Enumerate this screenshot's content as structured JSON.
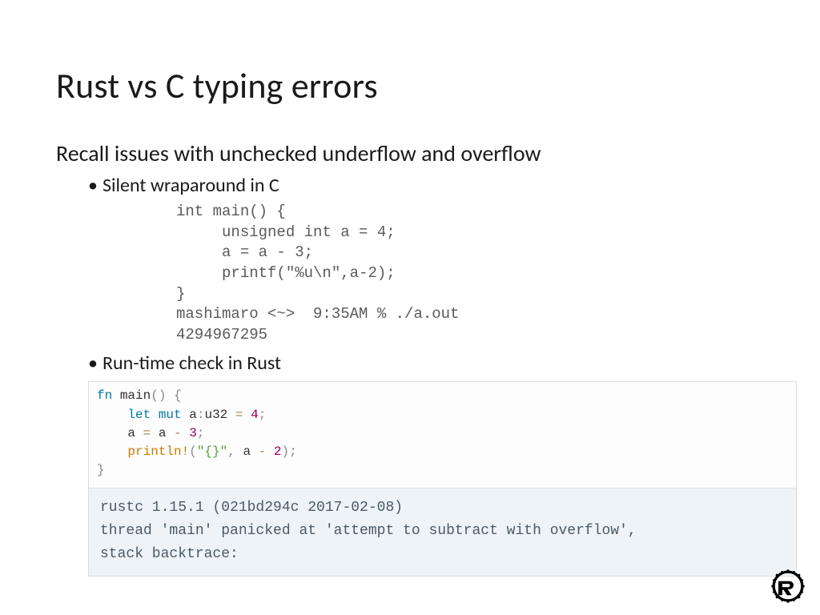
{
  "title": "Rust vs C typing errors",
  "intro": "Recall issues with unchecked underflow and overflow",
  "bullet1": "Silent wraparound in C",
  "bullet2": "Run-time check in Rust",
  "c_code": "int main() {\n     unsigned int a = 4;\n     a = a - 3;\n     printf(\"%u\\n\",a-2);\n}\nmashimaro <~>  9:35AM % ./a.out\n4294967295",
  "rust": {
    "kw_fn": "fn",
    "main": "main",
    "paren": "()",
    "ob": "{",
    "cb": "}",
    "kw_let": "let",
    "kw_mut": "mut",
    "var_a": "a",
    "colon": ":",
    "ty_u32": "u32",
    "eq": "=",
    "num4": "4",
    "semi": ";",
    "num3": "3",
    "minus": "-",
    "mac_println": "println!",
    "op_paren_o": "(",
    "op_paren_c": ")",
    "str_fmt": "\"{}\"",
    "comma": ",",
    "num2": "2"
  },
  "rust_output": "rustc 1.15.1 (021bd294c 2017-02-08)\nthread 'main' panicked at 'attempt to subtract with overflow',\nstack backtrace:"
}
